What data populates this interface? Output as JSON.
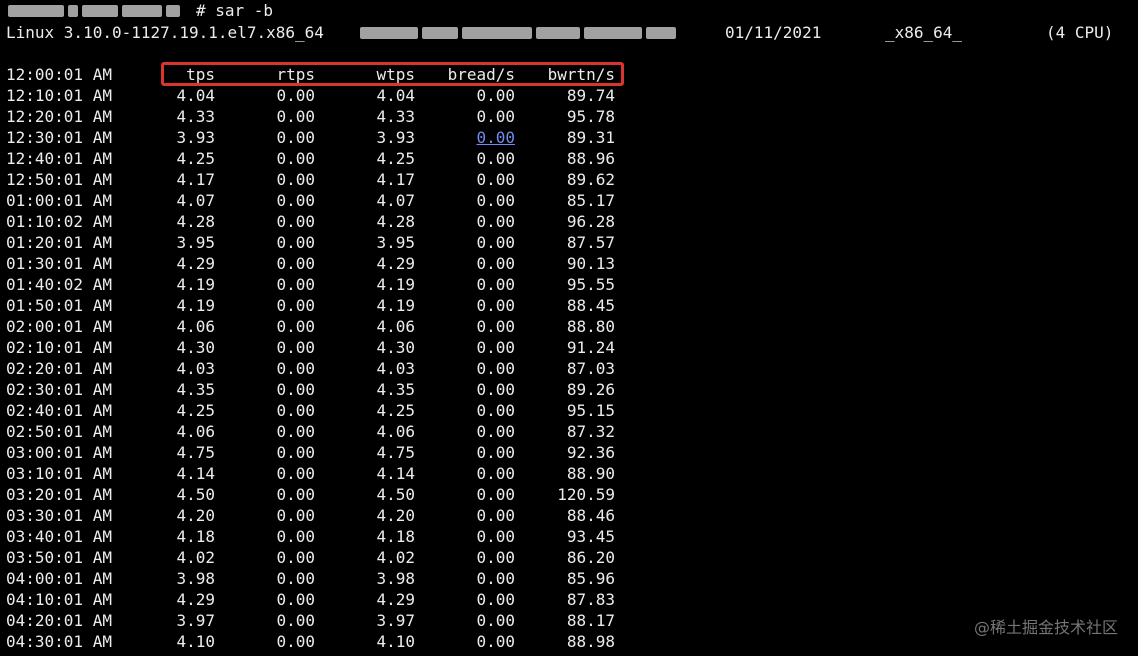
{
  "prompt": {
    "command": "# sar -b"
  },
  "sysinfo": {
    "kernel": "Linux 3.10.0-1127.19.1.el7.x86_64",
    "date": "01/11/2021",
    "arch": "_x86_64_",
    "cpu": "(4 CPU)"
  },
  "header": {
    "time": "12:00:01 AM",
    "columns": [
      "tps",
      "rtps",
      "wtps",
      "bread/s",
      "bwrtn/s"
    ]
  },
  "rows": [
    {
      "time": "12:10:01 AM",
      "tps": "4.04",
      "rtps": "0.00",
      "wtps": "4.04",
      "bread": "0.00",
      "bwrtn": "89.74"
    },
    {
      "time": "12:20:01 AM",
      "tps": "4.33",
      "rtps": "0.00",
      "wtps": "4.33",
      "bread": "0.00",
      "bwrtn": "95.78"
    },
    {
      "time": "12:30:01 AM",
      "tps": "3.93",
      "rtps": "0.00",
      "wtps": "3.93",
      "bread": "0.00",
      "bwrtn": "89.31",
      "bread_is_link": true
    },
    {
      "time": "12:40:01 AM",
      "tps": "4.25",
      "rtps": "0.00",
      "wtps": "4.25",
      "bread": "0.00",
      "bwrtn": "88.96"
    },
    {
      "time": "12:50:01 AM",
      "tps": "4.17",
      "rtps": "0.00",
      "wtps": "4.17",
      "bread": "0.00",
      "bwrtn": "89.62"
    },
    {
      "time": "01:00:01 AM",
      "tps": "4.07",
      "rtps": "0.00",
      "wtps": "4.07",
      "bread": "0.00",
      "bwrtn": "85.17"
    },
    {
      "time": "01:10:02 AM",
      "tps": "4.28",
      "rtps": "0.00",
      "wtps": "4.28",
      "bread": "0.00",
      "bwrtn": "96.28"
    },
    {
      "time": "01:20:01 AM",
      "tps": "3.95",
      "rtps": "0.00",
      "wtps": "3.95",
      "bread": "0.00",
      "bwrtn": "87.57"
    },
    {
      "time": "01:30:01 AM",
      "tps": "4.29",
      "rtps": "0.00",
      "wtps": "4.29",
      "bread": "0.00",
      "bwrtn": "90.13"
    },
    {
      "time": "01:40:02 AM",
      "tps": "4.19",
      "rtps": "0.00",
      "wtps": "4.19",
      "bread": "0.00",
      "bwrtn": "95.55"
    },
    {
      "time": "01:50:01 AM",
      "tps": "4.19",
      "rtps": "0.00",
      "wtps": "4.19",
      "bread": "0.00",
      "bwrtn": "88.45"
    },
    {
      "time": "02:00:01 AM",
      "tps": "4.06",
      "rtps": "0.00",
      "wtps": "4.06",
      "bread": "0.00",
      "bwrtn": "88.80"
    },
    {
      "time": "02:10:01 AM",
      "tps": "4.30",
      "rtps": "0.00",
      "wtps": "4.30",
      "bread": "0.00",
      "bwrtn": "91.24"
    },
    {
      "time": "02:20:01 AM",
      "tps": "4.03",
      "rtps": "0.00",
      "wtps": "4.03",
      "bread": "0.00",
      "bwrtn": "87.03"
    },
    {
      "time": "02:30:01 AM",
      "tps": "4.35",
      "rtps": "0.00",
      "wtps": "4.35",
      "bread": "0.00",
      "bwrtn": "89.26"
    },
    {
      "time": "02:40:01 AM",
      "tps": "4.25",
      "rtps": "0.00",
      "wtps": "4.25",
      "bread": "0.00",
      "bwrtn": "95.15"
    },
    {
      "time": "02:50:01 AM",
      "tps": "4.06",
      "rtps": "0.00",
      "wtps": "4.06",
      "bread": "0.00",
      "bwrtn": "87.32"
    },
    {
      "time": "03:00:01 AM",
      "tps": "4.75",
      "rtps": "0.00",
      "wtps": "4.75",
      "bread": "0.00",
      "bwrtn": "92.36"
    },
    {
      "time": "03:10:01 AM",
      "tps": "4.14",
      "rtps": "0.00",
      "wtps": "4.14",
      "bread": "0.00",
      "bwrtn": "88.90"
    },
    {
      "time": "03:20:01 AM",
      "tps": "4.50",
      "rtps": "0.00",
      "wtps": "4.50",
      "bread": "0.00",
      "bwrtn": "120.59"
    },
    {
      "time": "03:30:01 AM",
      "tps": "4.20",
      "rtps": "0.00",
      "wtps": "4.20",
      "bread": "0.00",
      "bwrtn": "88.46"
    },
    {
      "time": "03:40:01 AM",
      "tps": "4.18",
      "rtps": "0.00",
      "wtps": "4.18",
      "bread": "0.00",
      "bwrtn": "93.45"
    },
    {
      "time": "03:50:01 AM",
      "tps": "4.02",
      "rtps": "0.00",
      "wtps": "4.02",
      "bread": "0.00",
      "bwrtn": "86.20"
    },
    {
      "time": "04:00:01 AM",
      "tps": "3.98",
      "rtps": "0.00",
      "wtps": "3.98",
      "bread": "0.00",
      "bwrtn": "85.96"
    },
    {
      "time": "04:10:01 AM",
      "tps": "4.29",
      "rtps": "0.00",
      "wtps": "4.29",
      "bread": "0.00",
      "bwrtn": "87.83"
    },
    {
      "time": "04:20:01 AM",
      "tps": "3.97",
      "rtps": "0.00",
      "wtps": "3.97",
      "bread": "0.00",
      "bwrtn": "88.17"
    },
    {
      "time": "04:30:01 AM",
      "tps": "4.10",
      "rtps": "0.00",
      "wtps": "4.10",
      "bread": "0.00",
      "bwrtn": "88.98"
    }
  ],
  "watermark": "@稀土掘金技术社区",
  "colors": {
    "background": "#000000",
    "text": "#ececec",
    "highlight_box": "#d9352f",
    "link": "#6f8df1"
  }
}
